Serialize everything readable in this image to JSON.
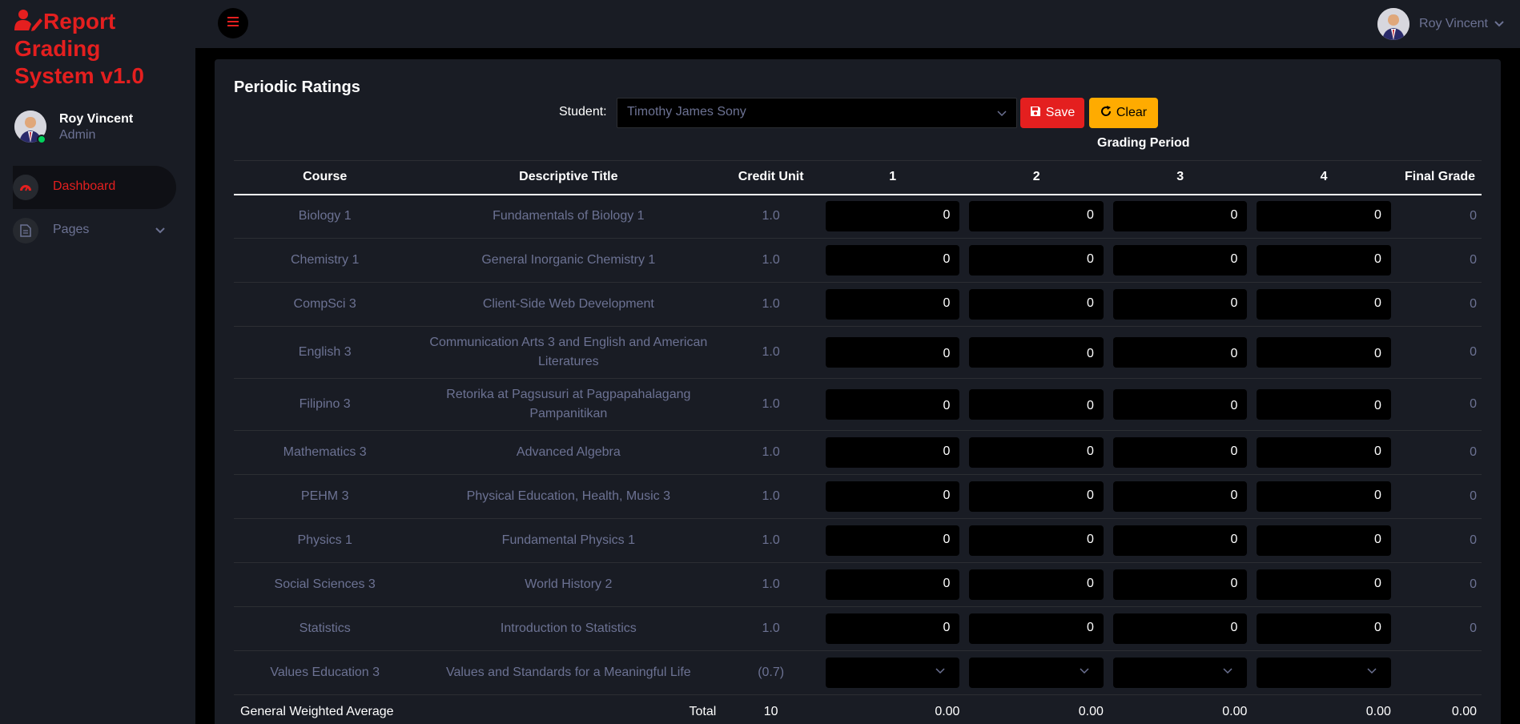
{
  "brand": {
    "lines": [
      "Report",
      "Grading",
      "System v1.0"
    ]
  },
  "profile": {
    "name": "Roy Vincent",
    "role": "Admin"
  },
  "nav": [
    {
      "label": "Dashboard",
      "icon": "speedometer-icon",
      "active": true
    },
    {
      "label": "Pages",
      "icon": "file-document-icon",
      "active": false
    }
  ],
  "topbar": {
    "user_name": "Roy Vincent"
  },
  "colors": {
    "accent": "#e41f1f",
    "warning": "#ffab00",
    "success": "#00d25b",
    "card_bg": "#191c24"
  },
  "page": {
    "title": "Periodic Ratings",
    "student_label": "Student:",
    "student_selected": "Timothy James Sony",
    "save_label": "Save",
    "clear_label": "Clear",
    "grading_period_label": "Grading Period"
  },
  "table": {
    "headers": [
      "Course",
      "Descriptive Title",
      "Credit Unit",
      "1",
      "2",
      "3",
      "4",
      "Final Grade"
    ],
    "rows": [
      {
        "course": "Biology 1",
        "title": "Fundamentals of Biology 1",
        "unit": "1.0",
        "grades": [
          "0",
          "0",
          "0",
          "0"
        ],
        "final": "0"
      },
      {
        "course": "Chemistry 1",
        "title": "General Inorganic Chemistry 1",
        "unit": "1.0",
        "grades": [
          "0",
          "0",
          "0",
          "0"
        ],
        "final": "0"
      },
      {
        "course": "CompSci 3",
        "title": "Client-Side Web Development",
        "unit": "1.0",
        "grades": [
          "0",
          "0",
          "0",
          "0"
        ],
        "final": "0"
      },
      {
        "course": "English 3",
        "title": "Communication Arts 3 and English and American Literatures",
        "unit": "1.0",
        "grades": [
          "0",
          "0",
          "0",
          "0"
        ],
        "final": "0"
      },
      {
        "course": "Filipino 3",
        "title": "Retorika at Pagsusuri at Pagpapahalagang Pampanitikan",
        "unit": "1.0",
        "grades": [
          "0",
          "0",
          "0",
          "0"
        ],
        "final": "0"
      },
      {
        "course": "Mathematics 3",
        "title": "Advanced Algebra",
        "unit": "1.0",
        "grades": [
          "0",
          "0",
          "0",
          "0"
        ],
        "final": "0"
      },
      {
        "course": "PEHM 3",
        "title": "Physical Education, Health, Music 3",
        "unit": "1.0",
        "grades": [
          "0",
          "0",
          "0",
          "0"
        ],
        "final": "0"
      },
      {
        "course": "Physics 1",
        "title": "Fundamental Physics 1",
        "unit": "1.0",
        "grades": [
          "0",
          "0",
          "0",
          "0"
        ],
        "final": "0"
      },
      {
        "course": "Social Sciences 3",
        "title": "World History 2",
        "unit": "1.0",
        "grades": [
          "0",
          "0",
          "0",
          "0"
        ],
        "final": "0"
      },
      {
        "course": "Statistics",
        "title": "Introduction to Statistics",
        "unit": "1.0",
        "grades": [
          "0",
          "0",
          "0",
          "0"
        ],
        "final": "0"
      },
      {
        "course": "Values Education 3",
        "title": "Values and Standards for a Meaningful Life",
        "unit": "(0.7)",
        "grades": [
          "",
          "",
          "",
          ""
        ],
        "final": "",
        "select": true
      }
    ],
    "footer": {
      "gwa_label": "General Weighted Average",
      "total_label": "Total",
      "total_units": "10",
      "period_averages": [
        "0.00",
        "0.00",
        "0.00",
        "0.00"
      ],
      "final_average": "0.00"
    }
  }
}
